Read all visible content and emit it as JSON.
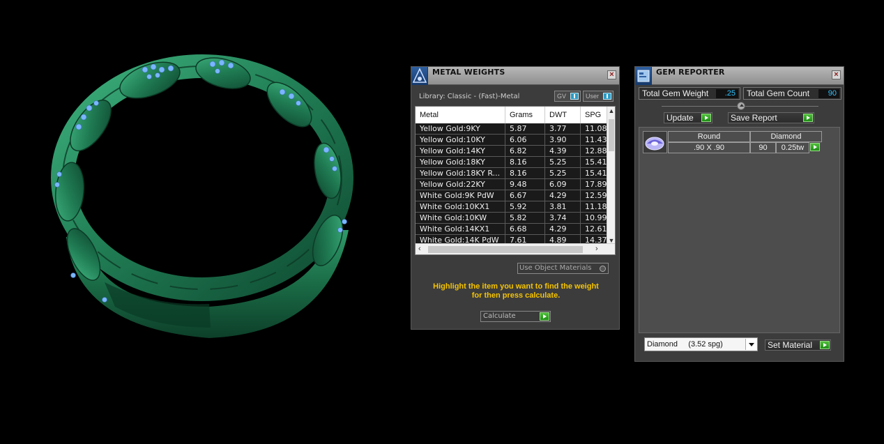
{
  "metal_weights": {
    "title": "METAL WEIGHTS",
    "library_label": "Library: Classic - (Fast)-Metal",
    "gv_label": "GV",
    "user_label": "User",
    "columns": [
      "Metal",
      "Grams",
      "DWT",
      "SPG"
    ],
    "rows": [
      [
        "Yellow Gold:9KY",
        "5.87",
        "3.77",
        "11.08"
      ],
      [
        "Yellow Gold:10KY",
        "6.06",
        "3.90",
        "11.43"
      ],
      [
        "Yellow Gold:14KY",
        "6.82",
        "4.39",
        "12.88"
      ],
      [
        "Yellow Gold:18KY",
        "8.16",
        "5.25",
        "15.41"
      ],
      [
        "Yellow Gold:18KY R...",
        "8.16",
        "5.25",
        "15.41"
      ],
      [
        "Yellow Gold:22KY",
        "9.48",
        "6.09",
        "17.89"
      ],
      [
        "White Gold:9K PdW",
        "6.67",
        "4.29",
        "12.59"
      ],
      [
        "White Gold:10KX1",
        "5.92",
        "3.81",
        "11.18"
      ],
      [
        "White Gold:10KW",
        "5.82",
        "3.74",
        "10.99"
      ],
      [
        "White Gold:14KX1",
        "6.68",
        "4.29",
        "12.61"
      ],
      [
        "White Gold:14K PdW",
        "7.61",
        "4.89",
        "14.37"
      ]
    ],
    "use_object_materials": "Use Object Materials",
    "hint_line1": "Highlight the item you want to find the weight",
    "hint_line2": "for then press calculate.",
    "calculate_label": "Calculate"
  },
  "gem_reporter": {
    "title": "GEM REPORTER",
    "total_gem_weight_label": "Total Gem Weight",
    "total_gem_weight_value": ".25",
    "total_gem_count_label": "Total Gem Count",
    "total_gem_count_value": "90",
    "update_label": "Update",
    "save_report_label": "Save Report",
    "gem": {
      "shape": "Round",
      "material": "Diamond",
      "size": ".90 X .90",
      "count": "90",
      "weight": "0.25tw"
    },
    "material_select": "Diamond     (3.52 spg)",
    "set_material_label": "Set Material"
  },
  "icons": {
    "metal_panel_icon": "metal-weights-icon",
    "gem_panel_icon": "gem-reporter-icon",
    "close": "close-icon"
  },
  "colors": {
    "ring_green": "#1f7a52",
    "gem_blue": "#7ab6ff",
    "hint_yellow": "#f5c400",
    "value_blue": "#33c3ff",
    "action_green": "#2fa524"
  }
}
